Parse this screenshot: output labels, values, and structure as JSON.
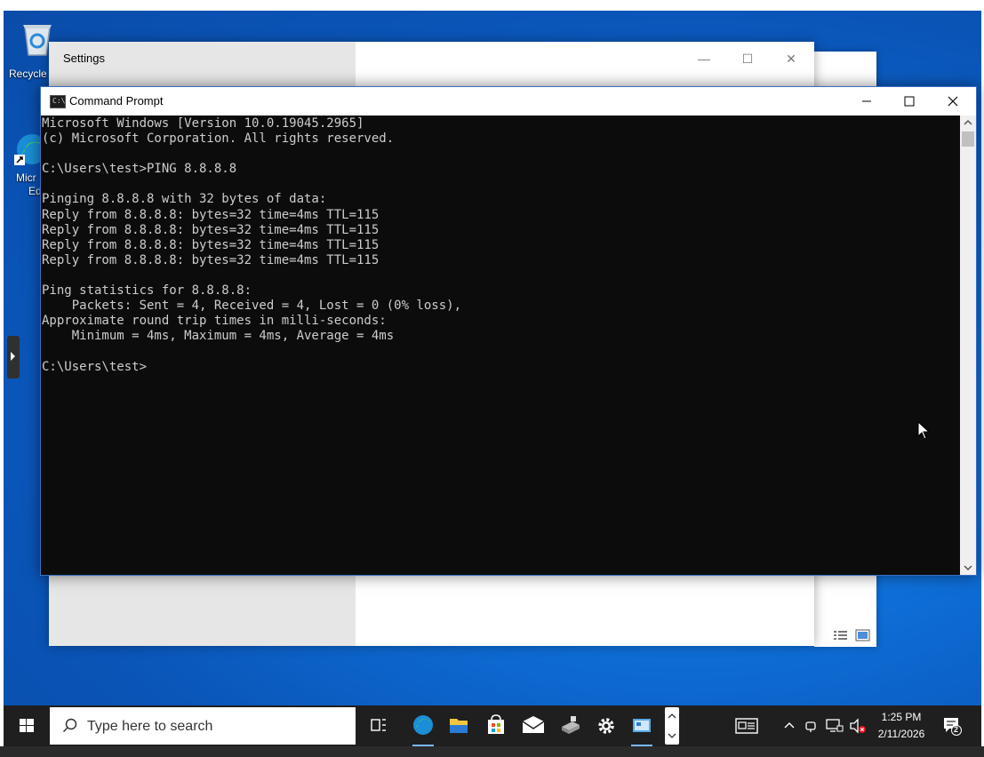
{
  "desktop": {
    "shortcuts": [
      {
        "label": "Recycle"
      },
      {
        "label_line1": "Micr",
        "label_line2": "Ed"
      }
    ]
  },
  "settings_window": {
    "title": "Settings",
    "controls": {
      "minimize": "—",
      "maximize": "☐",
      "close": "✕"
    }
  },
  "cmd_window": {
    "title": "Command Prompt",
    "icon_text": "C:\\",
    "lines": [
      "Microsoft Windows [Version 10.0.19045.2965]",
      "(c) Microsoft Corporation. All rights reserved.",
      "",
      "C:\\Users\\test>PING 8.8.8.8",
      "",
      "Pinging 8.8.8.8 with 32 bytes of data:",
      "Reply from 8.8.8.8: bytes=32 time=4ms TTL=115",
      "Reply from 8.8.8.8: bytes=32 time=4ms TTL=115",
      "Reply from 8.8.8.8: bytes=32 time=4ms TTL=115",
      "Reply from 8.8.8.8: bytes=32 time=4ms TTL=115",
      "",
      "Ping statistics for 8.8.8.8:",
      "    Packets: Sent = 4, Received = 4, Lost = 0 (0% loss),",
      "Approximate round trip times in milli-seconds:",
      "    Minimum = 4ms, Maximum = 4ms, Average = 4ms",
      "",
      "C:\\Users\\test>"
    ]
  },
  "taskbar": {
    "search_placeholder": "Type here to search",
    "apps": [
      "task-view",
      "edge",
      "file-explorer",
      "store",
      "mail",
      "network-app",
      "settings",
      "remote-desktop"
    ],
    "clock_time": "1:25 PM",
    "clock_date": "2/11/2026",
    "notification_count": "2"
  },
  "colors": {
    "desktop_blue": "#0e6fd8",
    "console_bg": "#0c0c0c",
    "console_text": "#cccccc",
    "taskbar": "#1f1f1f"
  }
}
